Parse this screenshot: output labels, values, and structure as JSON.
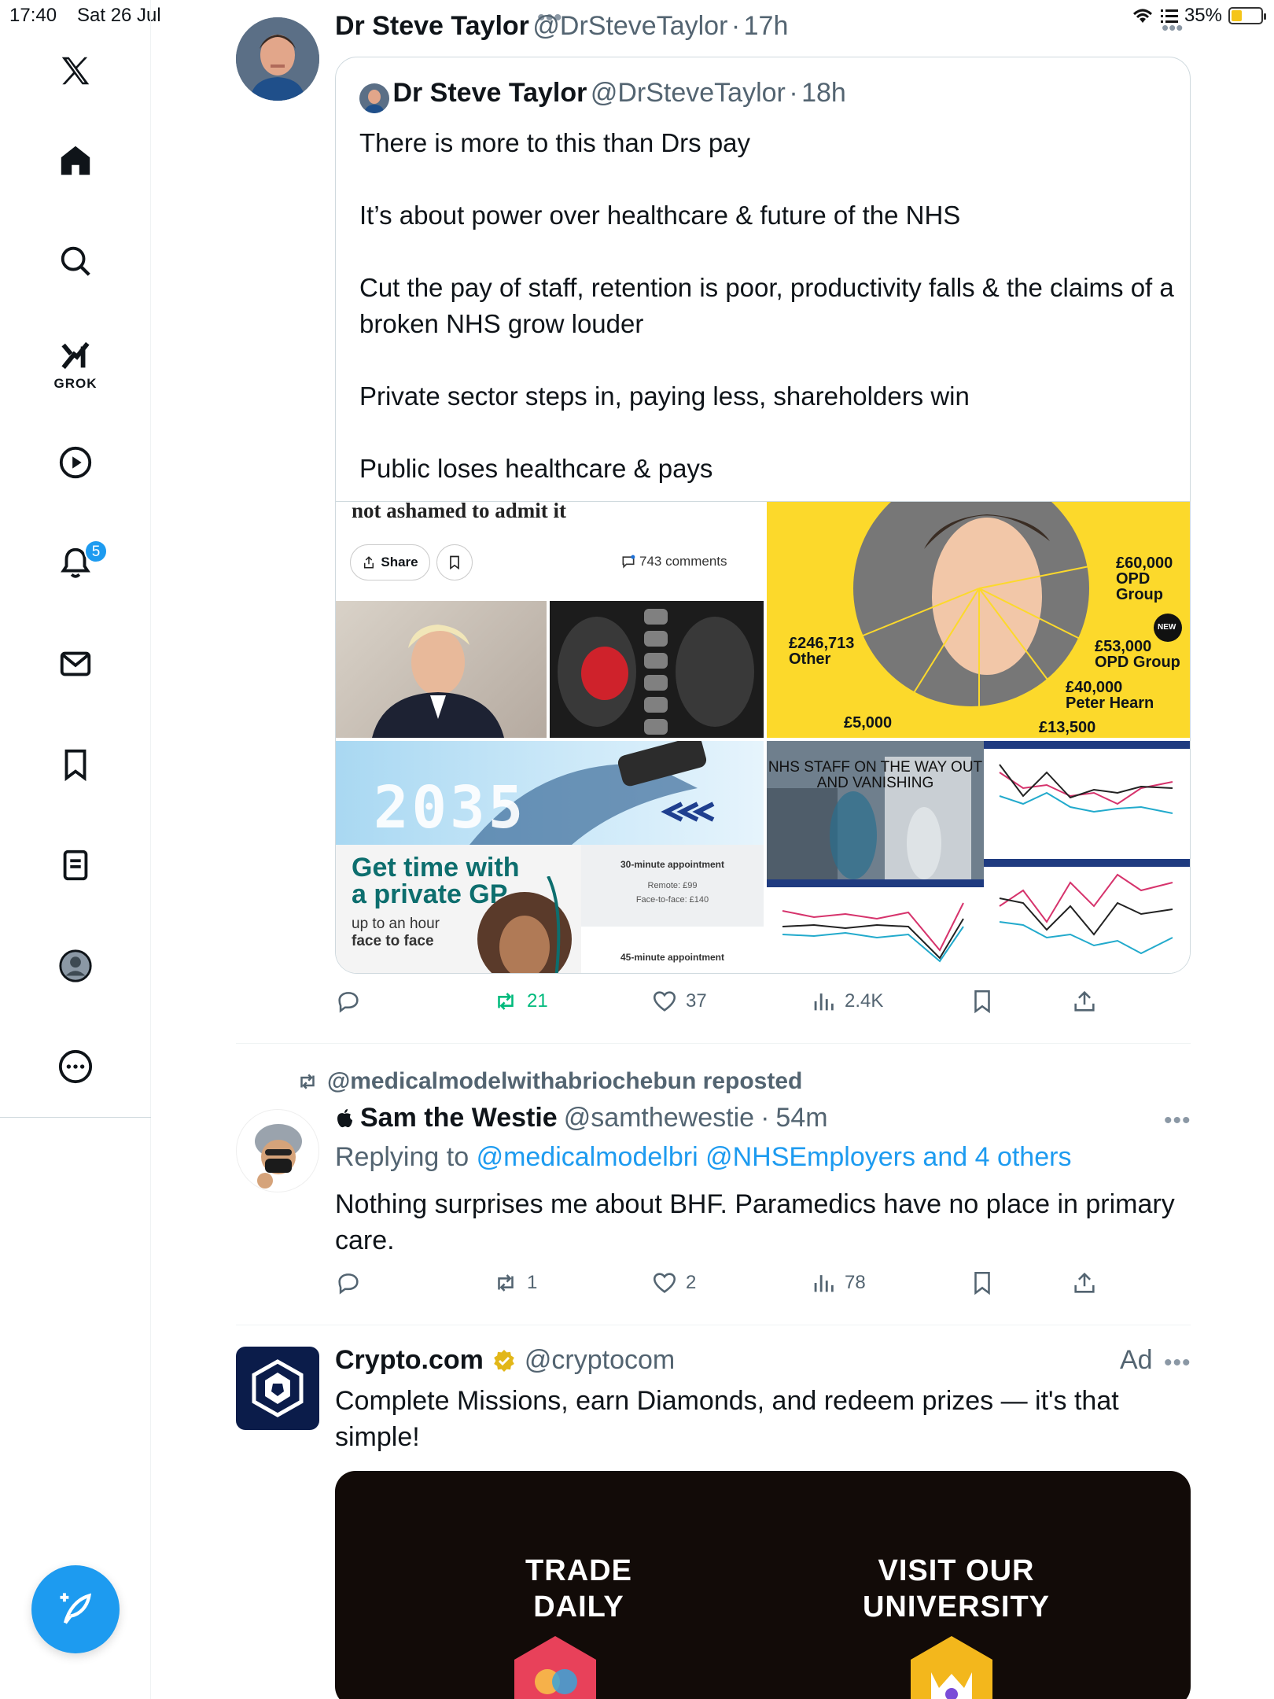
{
  "status": {
    "time": "17:40",
    "date": "Sat 26 Jul",
    "battery": "35%",
    "battery_level": 0.35
  },
  "sidebar": {
    "items": [
      {
        "icon": "x-logo-icon"
      },
      {
        "icon": "home-icon"
      },
      {
        "icon": "search-icon"
      },
      {
        "icon": "grok-icon",
        "label": "GROK"
      },
      {
        "icon": "video-play-icon"
      },
      {
        "icon": "bell-icon",
        "badge": "5"
      },
      {
        "icon": "mail-icon"
      },
      {
        "icon": "bookmark-icon"
      },
      {
        "icon": "list-icon"
      },
      {
        "icon": "profile-icon"
      },
      {
        "icon": "more-icon"
      }
    ]
  },
  "post1": {
    "name": "Dr Steve Taylor",
    "handle": "@DrSteveTaylor",
    "time": "17h",
    "quote": {
      "name": "Dr Steve Taylor",
      "handle": "@DrSteveTaylor",
      "time": "18h",
      "paragraphs": [
        "There is more to this than Drs pay",
        "It’s about power over healthcare & future of the NHS",
        "Cut the pay of staff, retention is poor, productivity falls & the claims of a broken NHS grow louder",
        "Private sector steps in, paying less, shareholders win",
        "Public loses healthcare & pays"
      ],
      "media": {
        "article": {
          "snippet": "not ashamed to admit it",
          "share": "Share",
          "comments": "743 comments"
        },
        "donations": {
          "l1": "£60,000",
          "l1b": "OPD",
          "l1c": "Group",
          "l2": "£246,713",
          "l2b": "Other",
          "l3": "£53,000",
          "l3b": "OPD Group",
          "l4": "£40,000",
          "l4b": "Peter Hearn",
          "l5": "£5,000",
          "l6": "£13,500",
          "new": "NEW"
        },
        "gp": {
          "year": "2035",
          "headline1": "Get time with",
          "headline2": "a private GP",
          "sub1": "up to an hour",
          "sub2": "face to face",
          "appt30": "30-minute appointment",
          "remote": "Remote: £99",
          "face": "Face-to-face: £140",
          "appt45": "45-minute appointment"
        },
        "nhs": {
          "title": "NHS STAFF ON THE WAY OUT AND VANISHING"
        }
      }
    },
    "stats": {
      "replies": "",
      "reposts": "21",
      "likes": "37",
      "views": "2.4K"
    }
  },
  "post2": {
    "repost_by": "@medicalmodelwithabriochebun reposted",
    "name": "Sam the Westie",
    "handle": "@samthewestie",
    "time": "54m",
    "replying_prefix": "Replying to",
    "replying_to": "@medicalmodelbri @NHSEmployers and 4 others",
    "text_l1": "Nothing surprises me about BHF. Paramedics have no place in primary",
    "text_l2": "care.",
    "stats": {
      "reposts": "1",
      "likes": "2",
      "views": "78"
    }
  },
  "post3": {
    "name": "Crypto.com",
    "handle": "@cryptocom",
    "ad_label": "Ad",
    "text_l1": "Complete Missions, earn Diamonds, and redeem prizes — it's that",
    "text_l2": "simple!",
    "card": {
      "left_l1": "TRADE",
      "left_l2": "DAILY",
      "right_l1": "VISIT OUR",
      "right_l2": "UNIVERSITY"
    }
  },
  "colors": {
    "accent": "#1d9bf0",
    "repost_green": "#00ba7c",
    "text_secondary": "#536471"
  }
}
